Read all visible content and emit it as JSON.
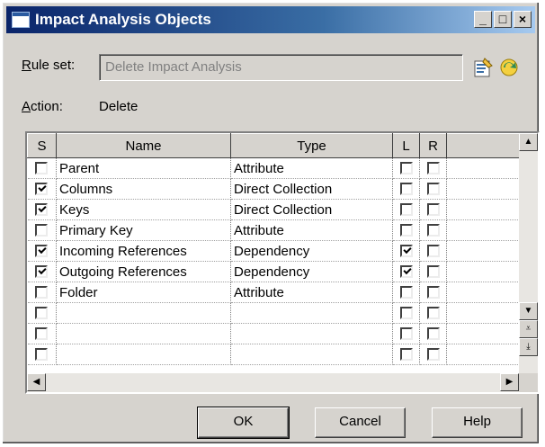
{
  "window": {
    "title": "Impact Analysis Objects",
    "controls": {
      "minimize": "_",
      "maximize": "□",
      "close": "×"
    }
  },
  "form": {
    "rule_set_label": "Rule set:",
    "rule_set_value": "Delete Impact Analysis",
    "action_label": "Action:",
    "action_value": "Delete"
  },
  "grid": {
    "columns": [
      "S",
      "Name",
      "Type",
      "L",
      "R"
    ],
    "rows": [
      {
        "s": false,
        "name": "Parent",
        "type": "Attribute",
        "l": false,
        "r": false
      },
      {
        "s": true,
        "name": "Columns",
        "type": "Direct Collection",
        "l": false,
        "r": false
      },
      {
        "s": true,
        "name": "Keys",
        "type": "Direct Collection",
        "l": false,
        "r": false
      },
      {
        "s": false,
        "name": "Primary Key",
        "type": "Attribute",
        "l": false,
        "r": false
      },
      {
        "s": true,
        "name": "Incoming References",
        "type": "Dependency",
        "l": true,
        "r": false
      },
      {
        "s": true,
        "name": "Outgoing References",
        "type": "Dependency",
        "l": true,
        "r": false
      },
      {
        "s": false,
        "name": "Folder",
        "type": "Attribute",
        "l": false,
        "r": false
      },
      {
        "s": false,
        "name": "",
        "type": "",
        "l": false,
        "r": false
      },
      {
        "s": false,
        "name": "",
        "type": "",
        "l": false,
        "r": false
      },
      {
        "s": false,
        "name": "",
        "type": "",
        "l": false,
        "r": false
      }
    ]
  },
  "buttons": {
    "ok": "OK",
    "cancel": "Cancel",
    "help": "Help"
  },
  "icons": [
    "properties-icon",
    "refresh-icon"
  ]
}
